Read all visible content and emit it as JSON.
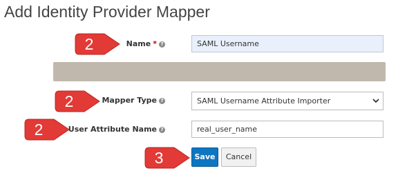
{
  "page": {
    "title": "Add Identity Provider Mapper"
  },
  "form": {
    "name": {
      "label": "Name",
      "required_marker": "*",
      "value": "SAML Username"
    },
    "mapper_type": {
      "label": "Mapper Type",
      "selected": "SAML Username Attribute Importer"
    },
    "user_attribute_name": {
      "label": "User Attribute Name",
      "value": "real_user_name"
    },
    "help_glyph": "?"
  },
  "buttons": {
    "save": "Save",
    "cancel": "Cancel"
  },
  "callouts": {
    "name": "2",
    "mapper_type": "2",
    "user_attribute_name": "2",
    "save": "3"
  },
  "colors": {
    "callout": "#e23a36",
    "save_button": "#0d76c2",
    "input_focus": "#e9f0fb",
    "redacted_bar": "#c0b8ac",
    "required": "#cc0000"
  },
  "icons": {
    "help": "question-circle-icon",
    "select_arrow": "chevron-down-icon"
  }
}
